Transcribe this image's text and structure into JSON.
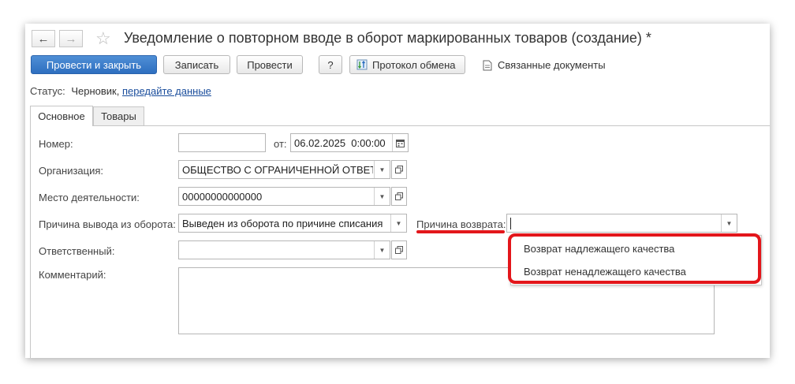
{
  "window": {
    "title": "Уведомление о повторном вводе в оборот маркированных товаров (создание) *"
  },
  "toolbar": {
    "post_close_label": "Провести и закрыть",
    "write_label": "Записать",
    "post_label": "Провести",
    "help_label": "?",
    "exchange_log_label": "Протокол обмена",
    "related_docs_label": "Связанные документы"
  },
  "status": {
    "label": "Статус:",
    "value": "Черновик,",
    "link": "передайте данные"
  },
  "tabs": [
    {
      "label": "Основное",
      "active": true
    },
    {
      "label": "Товары",
      "active": false
    }
  ],
  "form": {
    "number_label": "Номер:",
    "number_value": "",
    "date_label": "от:",
    "date_value": "06.02.2025  0:00:00",
    "org_label": "Организация:",
    "org_value": "ОБЩЕСТВО С ОГРАНИЧЕННОЙ ОТВЕТСТВЕННОСТЬЮ",
    "place_label": "Место деятельности:",
    "place_value": "00000000000000",
    "reason_label": "Причина вывода из оборота:",
    "reason_value": "Выведен из оборота по причине списания",
    "return_reason_label": "Причина возврата:",
    "return_reason_value": "",
    "responsible_label": "Ответственный:",
    "responsible_value": "",
    "comment_label": "Комментарий:",
    "comment_value": ""
  },
  "dropdown": {
    "options": [
      "Возврат надлежащего качества",
      "Возврат ненадлежащего качества"
    ]
  },
  "colors": {
    "primary": "#2e6fc0",
    "annotation": "#e3161b",
    "link": "#1a4d9c"
  }
}
